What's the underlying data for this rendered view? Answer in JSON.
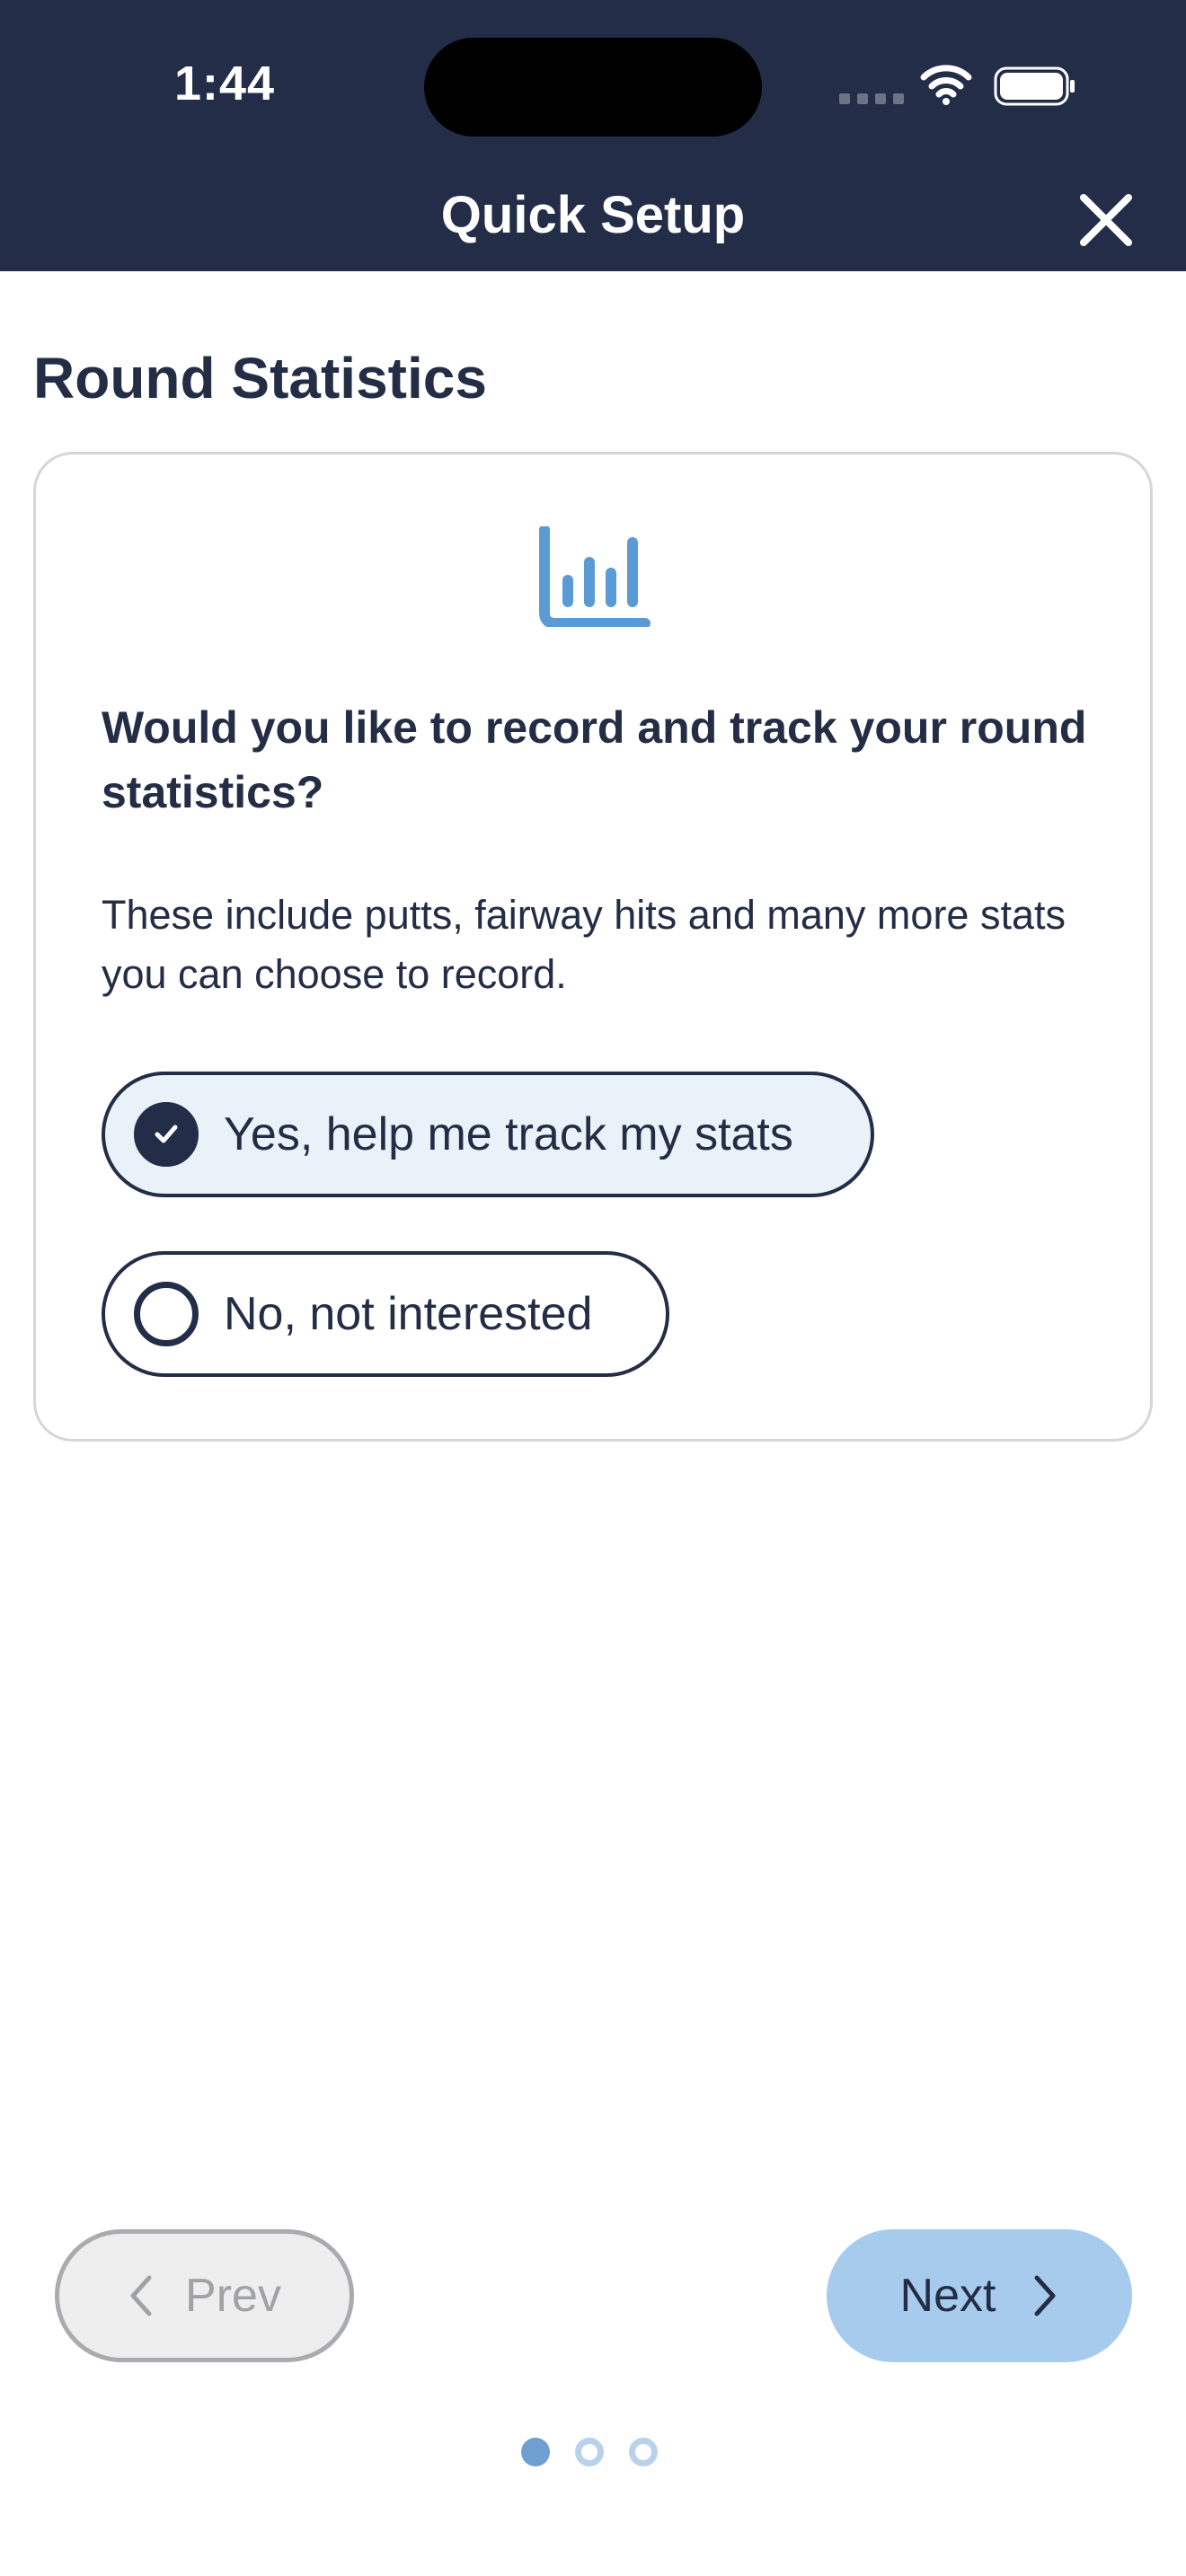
{
  "status_bar": {
    "time": "1:44"
  },
  "header": {
    "title": "Quick Setup",
    "close_icon": "close-x-icon"
  },
  "section": {
    "title": "Round Statistics"
  },
  "card": {
    "icon": "bar-chart-icon",
    "question": "Would you like to record and track your round statistics?",
    "description": "These include putts, fairway hits and many more stats you can choose to record.",
    "options": [
      {
        "label": "Yes, help me track my stats",
        "selected": true
      },
      {
        "label": "No, not interested",
        "selected": false
      }
    ]
  },
  "navigation": {
    "prev_label": "Prev",
    "next_label": "Next",
    "prev_enabled": false,
    "next_enabled": true,
    "page_count": 3,
    "current_page": 1
  },
  "colors": {
    "header_bg": "#232d48",
    "accent_blue": "#5b9bd5",
    "next_button_bg": "#a7cbec",
    "selected_option_bg": "#e9f1f9",
    "text_dark": "#232d45"
  }
}
